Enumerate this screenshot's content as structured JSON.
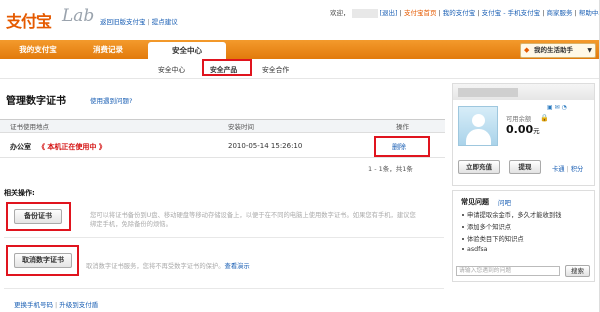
{
  "header": {
    "logo_text": "支付宝",
    "logo_lab": "Lab",
    "top_links": [
      "返回旧版支付宝",
      "提点建议"
    ],
    "user_bar": {
      "welcome": "欢迎，",
      "logout": "[退出]",
      "links": [
        "支付宝首页",
        "我的支付宝",
        "支付宝 - 手机支付宝",
        "商家服务",
        "帮助中心"
      ]
    }
  },
  "nav": {
    "tabs": [
      "我的支付宝",
      "消费记录",
      "安全中心"
    ],
    "helper": "我的生活助手",
    "subnav": [
      "安全中心",
      "安全产品",
      "安全合作"
    ]
  },
  "main": {
    "heading": "管理数字证书",
    "help_link": "使用遇到问题?",
    "table": {
      "headers": [
        "证书使用地点",
        "安装时间",
        "操作"
      ],
      "rows": [
        {
          "location": "办公室",
          "status": "《 本机正在使用中 》",
          "time": "2010-05-14 15:26:10",
          "action": "删除"
        }
      ],
      "pager": "1 - 1条，共1条"
    },
    "related_title": "相关操作:",
    "backup_button": "备份证书",
    "backup_desc": "您可以将证书备份到U盘、移动硬盘等移动存储设备上，以便于在不同的电脑上使用数字证书。如果您有手机，建议您绑定手机，免除备份的烦恼。",
    "cancel_button": "取消数字证书",
    "cancel_desc": "取消数字证书服务，您将不再受数字证书的保护。",
    "cancel_link": "查看演示",
    "footer_links": [
      "更换手机号码",
      "升级到支付盾"
    ]
  },
  "account": {
    "balance_label": "可用余额",
    "balance_value": "0.00",
    "balance_unit": "元",
    "recharge": "立即充值",
    "withdraw": "提现",
    "card_link": "卡通",
    "points_link": "积分"
  },
  "faq": {
    "title": "常见问题",
    "more": "问吧",
    "items": [
      "申请提取余金币，多久才能收到钱",
      "添加多个知识点",
      "体验类目下的知识点",
      "asdfsa"
    ],
    "search_placeholder": "请输入您遇到的问题",
    "search_button": "搜索"
  },
  "colors": {
    "brand_orange": "#e27a0c",
    "highlight_red": "#e0141e",
    "link_blue": "#1a5fb4"
  }
}
